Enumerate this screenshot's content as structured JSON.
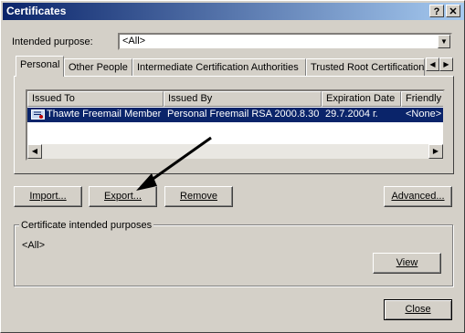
{
  "window": {
    "title": "Certificates",
    "help_btn": "?",
    "close_btn": "✕"
  },
  "purpose": {
    "label": "Intended purpose:",
    "value": "<All>"
  },
  "tabs": [
    {
      "label": "Personal",
      "active": true
    },
    {
      "label": "Other People",
      "active": false
    },
    {
      "label": "Intermediate Certification Authorities",
      "active": false
    },
    {
      "label": "Trusted Root Certification",
      "active": false
    }
  ],
  "table": {
    "columns": [
      "Issued To",
      "Issued By",
      "Expiration Date",
      "Friendly"
    ],
    "rows": [
      {
        "issued_to": "Thawte Freemail Member",
        "issued_by": "Personal Freemail RSA 2000.8.30",
        "expiration": "29.7.2004 г.",
        "friendly": "<None>",
        "selected": true
      }
    ]
  },
  "buttons": {
    "import": "Import...",
    "export": "Export...",
    "remove": "Remove",
    "advanced": "Advanced...",
    "view": "View",
    "close": "Close"
  },
  "purposes_group": {
    "title": "Certificate intended purposes",
    "value": "<All>"
  },
  "colors": {
    "selection": "#0a246a",
    "titlebar_start": "#0a246a",
    "titlebar_end": "#a6caf0",
    "face": "#d4d0c8"
  },
  "icons": [
    "help-icon",
    "close-icon",
    "dropdown-arrow-icon",
    "tab-scroll-left-icon",
    "tab-scroll-right-icon",
    "certificate-icon",
    "scroll-left-icon",
    "scroll-right-icon",
    "arrow-annotation-icon"
  ]
}
